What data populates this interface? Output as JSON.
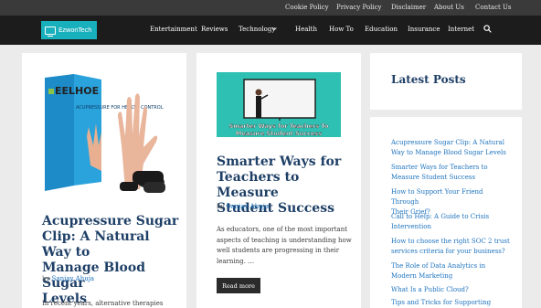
{
  "top_links": [
    "Cookie Policy",
    "Privacy Policy",
    "Disclaimer",
    "About Us",
    "Contact Us"
  ],
  "site": {
    "logo_text": "EzwonTech"
  },
  "nav": [
    "Entertainment",
    "Reviews",
    "Technology",
    "Health",
    "How To",
    "Education",
    "Insurance",
    "Internet"
  ],
  "posts": [
    {
      "image_brand": "EELHOE",
      "image_caption": "ACUPRESSURE FOR HEALTH CONTROL",
      "title_lines": [
        "Acupressure Sugar",
        "Clip: A Natural Way to",
        "Manage Blood Sugar",
        "Levels"
      ],
      "by": "by",
      "author": "Sanjay Ahuja",
      "excerpt_lines": [
        "In recent years, alternative therapies have"
      ]
    },
    {
      "image_caption_lines": [
        "Smarter Ways for Teachers To",
        "Measure Student Success"
      ],
      "title_lines": [
        "Smarter Ways for",
        "Teachers to Measure",
        "Student Success"
      ],
      "by": "by",
      "author": "Sanjay Ahuja",
      "excerpt_lines": [
        "As educators, one of the most important",
        "aspects of teaching is understanding how",
        "well students are progressing in their",
        "learning. …"
      ],
      "read_more": "Read more"
    }
  ],
  "sidebar": {
    "title": "Latest Posts",
    "links": [
      [
        "Acupressure Sugar Clip: A Natural",
        "Way to Manage Blood Sugar Levels"
      ],
      [
        "Smarter Ways for Teachers to",
        "Measure Student Success"
      ],
      [
        "How to Support Your Friend Through",
        "Their Grief?"
      ],
      [
        "Call to Help: A Guide to Crisis",
        "Intervention"
      ],
      [
        "How to choose the right SOC 2 trust",
        "services criteria for your business?"
      ],
      [
        "The Role of Data Analytics in",
        "Modern Marketing"
      ],
      [
        "What Is a Public Cloud?"
      ],
      [
        "Tips and Tricks for Supporting"
      ]
    ]
  },
  "colors": {
    "accent": "#19b0bd",
    "heading": "#1e3f66",
    "link": "#1e73be"
  },
  "icons": [
    "chevron-down-icon",
    "search-icon"
  ]
}
